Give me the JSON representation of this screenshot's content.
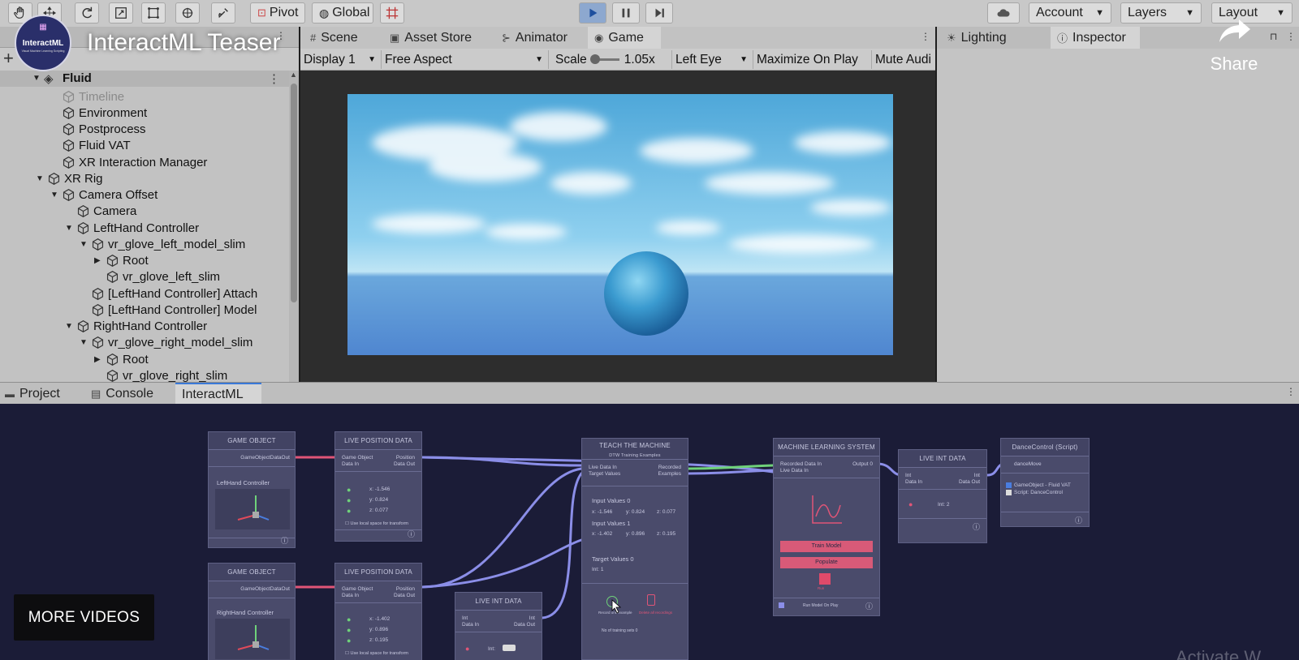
{
  "video": {
    "title": "InteractML Teaser",
    "channel_logo_text": "InteractML",
    "channel_logo_sub": "Visual Machine Learning Scripting",
    "share_label": "Share",
    "more_videos_label": "MORE VIDEOS",
    "watermark": "Activate W"
  },
  "toolbar": {
    "pivot_label": "Pivot",
    "global_label": "Global",
    "account_label": "Account",
    "layers_label": "Layers",
    "layout_label": "Layout"
  },
  "hierarchy": {
    "scene_name": "Fluid",
    "items": [
      {
        "label": "Timeline",
        "depth": 2,
        "arrow": "",
        "dim": true
      },
      {
        "label": "Environment",
        "depth": 2,
        "arrow": ""
      },
      {
        "label": "Postprocess",
        "depth": 2,
        "arrow": ""
      },
      {
        "label": "Fluid VAT",
        "depth": 2,
        "arrow": ""
      },
      {
        "label": "XR Interaction Manager",
        "depth": 2,
        "arrow": ""
      },
      {
        "label": "XR Rig",
        "depth": 1,
        "arrow": "▼"
      },
      {
        "label": "Camera Offset",
        "depth": 2,
        "arrow": "▼"
      },
      {
        "label": "Camera",
        "depth": 3,
        "arrow": ""
      },
      {
        "label": "LeftHand Controller",
        "depth": 3,
        "arrow": "▼"
      },
      {
        "label": "vr_glove_left_model_slim",
        "depth": 4,
        "arrow": "▼"
      },
      {
        "label": "Root",
        "depth": 5,
        "arrow": "▶"
      },
      {
        "label": "vr_glove_left_slim",
        "depth": 5,
        "arrow": ""
      },
      {
        "label": "[LeftHand Controller] Attach",
        "depth": 4,
        "arrow": ""
      },
      {
        "label": "[LeftHand Controller] Model",
        "depth": 4,
        "arrow": ""
      },
      {
        "label": "RightHand Controller",
        "depth": 3,
        "arrow": "▼"
      },
      {
        "label": "vr_glove_right_model_slim",
        "depth": 4,
        "arrow": "▼"
      },
      {
        "label": "Root",
        "depth": 5,
        "arrow": "▶"
      },
      {
        "label": "vr_glove_right_slim",
        "depth": 5,
        "arrow": ""
      }
    ]
  },
  "game_view": {
    "tabs": [
      {
        "label": "Scene",
        "icon": "#"
      },
      {
        "label": "Asset Store",
        "icon": "▣"
      },
      {
        "label": "Animator",
        "icon": "⊱"
      },
      {
        "label": "Game",
        "icon": "◉"
      }
    ],
    "display_label": "Display 1",
    "aspect_label": "Free Aspect",
    "scale_label": "Scale",
    "scale_value": "1.05x",
    "eye_label": "Left Eye",
    "maximize_label": "Maximize On Play",
    "mute_label": "Mute Audi"
  },
  "inspector": {
    "tabs": [
      {
        "label": "Lighting",
        "icon": "☀"
      },
      {
        "label": "Inspector",
        "icon": "ⓘ"
      }
    ]
  },
  "bottom_panel": {
    "tabs": [
      {
        "label": "Project",
        "icon": "▬"
      },
      {
        "label": "Console",
        "icon": "▤"
      },
      {
        "label": "InteractML",
        "icon": ""
      }
    ]
  },
  "graph": {
    "game_object_title": "GAME OBJECT",
    "game_object_out": "GameObjectDataOut",
    "left_hand_label": "LeftHand Controller",
    "right_hand_label": "RightHand Controller",
    "live_position_title": "LIVE POSITION DATA",
    "port_go_in": "Game Object",
    "port_data_in": "Data In",
    "port_position": "Position",
    "port_data_out": "Data Out",
    "left_pos": {
      "x": "x: -1.546",
      "y": "y: 0.824",
      "z": "z: 0.077"
    },
    "right_pos": {
      "x": "x: -1.402",
      "y": "y: 0.896",
      "z": "z: 0.195"
    },
    "use_local_space": "Use local space for transform",
    "teach_title": "TEACH THE MACHINE",
    "teach_sub": "DTW Training Examples",
    "port_live_data_in": "Live Data In",
    "port_target_values": "Target Values",
    "port_recorded": "Recorded",
    "port_examples": "Examples",
    "input_values_0": "Input Values 0",
    "iv0": {
      "x": "x: -1.546",
      "y": "y: 0.824",
      "z": "z: 0.077"
    },
    "input_values_1": "Input Values 1",
    "iv1": {
      "x": "x: -1.402",
      "y": "y: 0.896",
      "z": "z: 0.195"
    },
    "target_values_0": "Target Values 0",
    "target_int": "Int: 1",
    "record_label": "Record one example",
    "delete_label": "Delete all recordings",
    "num_examples": "No of training sets 0",
    "ml_title": "MACHINE LEARNING SYSTEM",
    "port_recorded_in": "Recorded Data In",
    "port_output": "Output 0",
    "train_label": "Train Model",
    "populate_label": "Populate",
    "run_label": "Run",
    "run_on_play": "Run Model On Play",
    "live_int_title": "LIVE INT DATA",
    "port_int": "Int",
    "int_value": "Int: 2",
    "int_value_bottom": "Int:",
    "dance_title": "DanceControl (Script)",
    "dance_port": "danceMove",
    "dance_go": "GameObject - Fluid VAT",
    "dance_script": "Script: DanceControl"
  }
}
